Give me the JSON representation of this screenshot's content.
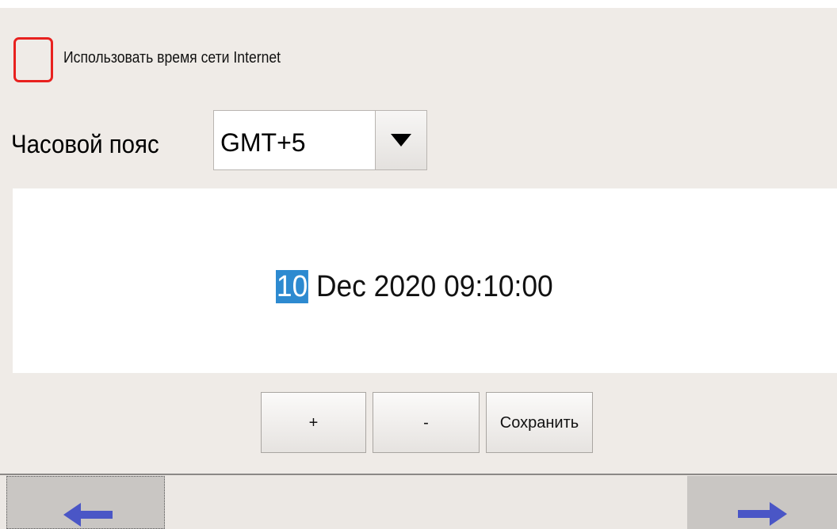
{
  "ntp": {
    "label": "Использовать время сети Internet",
    "checked": false,
    "border_color": "#e8211f"
  },
  "timezone": {
    "label": "Часовой пояс",
    "value": "GMT+5",
    "dropdown_icon": "caret-down-icon"
  },
  "datetime": {
    "selected_field": "10",
    "rest": " Dec 2020 09:10:00",
    "highlight_color": "#2d8ad0"
  },
  "actions": {
    "plus_label": "+",
    "minus_label": "-",
    "save_label": "Сохранить"
  },
  "navigation": {
    "back_icon": "arrow-left-icon",
    "next_icon": "arrow-right-icon",
    "arrow_color": "#4a56c6"
  }
}
